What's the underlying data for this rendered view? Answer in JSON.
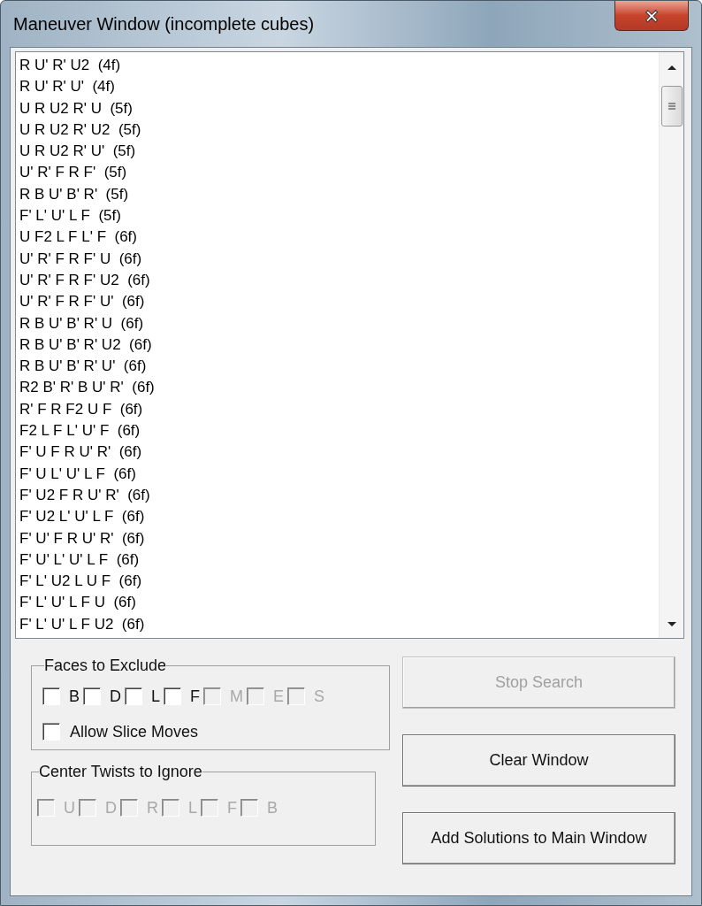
{
  "window": {
    "title": "Maneuver Window (incomplete cubes)",
    "close": "×"
  },
  "solutions": [
    "R U' R' U2  (4f)",
    "R U' R' U'  (4f)",
    "U R U2 R' U  (5f)",
    "U R U2 R' U2  (5f)",
    "U R U2 R' U'  (5f)",
    "U' R' F R F'  (5f)",
    "R B U' B' R'  (5f)",
    "F' L' U' L F  (5f)",
    "U F2 L F L' F  (6f)",
    "U' R' F R F' U  (6f)",
    "U' R' F R F' U2  (6f)",
    "U' R' F R F' U'  (6f)",
    "R B U' B' R' U  (6f)",
    "R B U' B' R' U2  (6f)",
    "R B U' B' R' U'  (6f)",
    "R2 B' R' B U' R'  (6f)",
    "R' F R F2 U F  (6f)",
    "F2 L F L' U' F  (6f)",
    "F' U F R U' R'  (6f)",
    "F' U L' U' L F  (6f)",
    "F' U2 F R U' R'  (6f)",
    "F' U2 L' U' L F  (6f)",
    "F' U' F R U' R'  (6f)",
    "F' U' L' U' L F  (6f)",
    "F' L' U2 L U F  (6f)",
    "F' L' U' L F U  (6f)",
    "F' L' U' L F U2  (6f)"
  ],
  "faces_to_exclude": {
    "title": "Faces to Exclude",
    "faces": [
      {
        "label": "B",
        "checked": false,
        "disabled": false
      },
      {
        "label": "D",
        "checked": false,
        "disabled": false
      },
      {
        "label": "L",
        "checked": false,
        "disabled": false
      },
      {
        "label": "F",
        "checked": false,
        "disabled": false
      },
      {
        "label": "M",
        "checked": false,
        "disabled": true
      },
      {
        "label": "E",
        "checked": false,
        "disabled": true
      },
      {
        "label": "S",
        "checked": false,
        "disabled": true
      }
    ],
    "allow_slice_moves": {
      "label": "Allow Slice Moves",
      "checked": false,
      "disabled": false
    }
  },
  "center_twists_to_ignore": {
    "title": "Center Twists to Ignore",
    "faces": [
      {
        "label": "U",
        "checked": false,
        "disabled": true
      },
      {
        "label": "D",
        "checked": false,
        "disabled": true
      },
      {
        "label": "R",
        "checked": false,
        "disabled": true
      },
      {
        "label": "L",
        "checked": false,
        "disabled": true
      },
      {
        "label": "F",
        "checked": false,
        "disabled": true
      },
      {
        "label": "B",
        "checked": false,
        "disabled": true
      }
    ]
  },
  "buttons": [
    {
      "label": "Stop Search",
      "disabled": true
    },
    {
      "label": "Clear Window",
      "disabled": false
    },
    {
      "label": "Add Solutions to Main Window",
      "disabled": false
    }
  ]
}
